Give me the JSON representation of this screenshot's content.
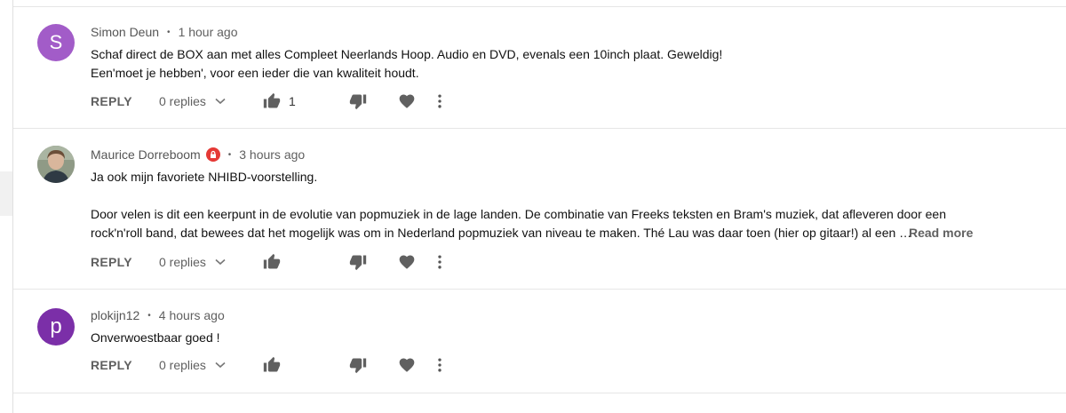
{
  "comments": [
    {
      "author": "Simon Deun",
      "time": "1 hour ago",
      "avatar_letter": "S",
      "avatar_color": "#a25cc8",
      "lines": [
        "Schaf direct de BOX aan met alles Compleet Neerlands Hoop. Audio en DVD, evenals een 10inch plaat. Geweldig!",
        "Een'moet je hebben', voor een ieder die van kwaliteit houdt."
      ],
      "reply_label": "REPLY",
      "replies_label": "0 replies",
      "like_count": "1"
    },
    {
      "author": "Maurice Dorreboom",
      "time": "3 hours ago",
      "lines": [
        "Ja ook mijn favoriete NHIBD-voorstelling.",
        "Door velen is dit een keerpunt in de evolutie van popmuziek in de lage landen. De combinatie van Freeks teksten en Bram's muziek, dat afleveren door een",
        "rock'n'roll band, dat bewees dat het mogelijk was om in Nederland popmuziek van niveau te maken. Thé Lau was daar toen (hier op gitaar!) al een …"
      ],
      "read_more": "Read more",
      "reply_label": "REPLY",
      "replies_label": "0 replies"
    },
    {
      "author": "plokijn12",
      "time": "4 hours ago",
      "avatar_letter": "p",
      "avatar_color": "#7b2fa8",
      "lines": [
        "Onverwoestbaar goed !"
      ],
      "reply_label": "REPLY",
      "replies_label": "0 replies"
    }
  ],
  "colors": {
    "meta_text": "#606060",
    "badge": "#e53935",
    "icon": "#606060"
  },
  "icons": [
    "thumb-up-icon",
    "thumb-down-icon",
    "heart-icon",
    "more-vert-icon",
    "chevron-down-icon",
    "lock-badge-icon"
  ]
}
